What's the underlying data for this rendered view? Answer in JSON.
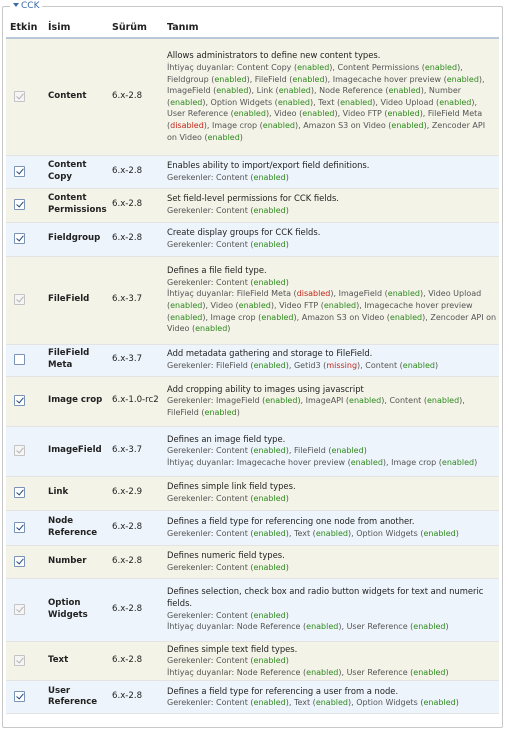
{
  "fieldset": {
    "legend": "CCK"
  },
  "table": {
    "headers": {
      "enabled": "Etkin",
      "name": "İsim",
      "version": "Sürüm",
      "description": "Tanım"
    },
    "required_by_label": "İhtiyaç duyanlar:",
    "depends_on_label": "Gerekenler:",
    "rows": [
      {
        "name": "Content",
        "version": "6.x-2.8",
        "checked": true,
        "locked": true,
        "description": "Allows administrators to define new content types.",
        "required_by": [
          [
            "Content Copy",
            "enabled"
          ],
          [
            "Content Permissions",
            "enabled"
          ],
          [
            "Fieldgroup",
            "enabled"
          ],
          [
            "FileField",
            "enabled"
          ],
          [
            "Imagecache hover preview",
            "enabled"
          ],
          [
            "ImageField",
            "enabled"
          ],
          [
            "Link",
            "enabled"
          ],
          [
            "Node Reference",
            "enabled"
          ],
          [
            "Number",
            "enabled"
          ],
          [
            "Option Widgets",
            "enabled"
          ],
          [
            "Text",
            "enabled"
          ],
          [
            "Video Upload",
            "enabled"
          ],
          [
            "User Reference",
            "enabled"
          ],
          [
            "Video",
            "enabled"
          ],
          [
            "Video FTP",
            "enabled"
          ],
          [
            "FileField Meta",
            "disabled"
          ],
          [
            "Image crop",
            "enabled"
          ],
          [
            "Amazon S3 on Video",
            "enabled"
          ],
          [
            "Zencoder API on Video",
            "enabled"
          ]
        ],
        "depends_on": []
      },
      {
        "name": "Content Copy",
        "version": "6.x-2.8",
        "checked": true,
        "locked": false,
        "description": "Enables ability to import/export field definitions.",
        "required_by": [],
        "depends_on": [
          [
            "Content",
            "enabled"
          ]
        ]
      },
      {
        "name": "Content Permissions",
        "version": "6.x-2.8",
        "checked": true,
        "locked": false,
        "description": "Set field-level permissions for CCK fields.",
        "required_by": [],
        "depends_on": [
          [
            "Content",
            "enabled"
          ]
        ]
      },
      {
        "name": "Fieldgroup",
        "version": "6.x-2.8",
        "checked": true,
        "locked": false,
        "description": "Create display groups for CCK fields.",
        "required_by": [],
        "depends_on": [
          [
            "Content",
            "enabled"
          ]
        ]
      },
      {
        "name": "FileField",
        "version": "6.x-3.7",
        "checked": true,
        "locked": true,
        "description": "Defines a file field type.",
        "depends_on": [
          [
            "Content",
            "enabled"
          ]
        ],
        "required_by": [
          [
            "FileField Meta",
            "disabled"
          ],
          [
            "ImageField",
            "enabled"
          ],
          [
            "Video Upload",
            "enabled"
          ],
          [
            "Video",
            "enabled"
          ],
          [
            "Video FTP",
            "enabled"
          ],
          [
            "Imagecache hover preview",
            "enabled"
          ],
          [
            "Image crop",
            "enabled"
          ],
          [
            "Amazon S3 on Video",
            "enabled"
          ],
          [
            "Zencoder API on Video",
            "enabled"
          ]
        ]
      },
      {
        "name": "FileField Meta",
        "version": "6.x-3.7",
        "checked": false,
        "locked": false,
        "description": "Add metadata gathering and storage to FileField.",
        "required_by": [],
        "depends_on": [
          [
            "FileField",
            "enabled"
          ],
          [
            "Getid3",
            "missing"
          ],
          [
            "Content",
            "enabled"
          ]
        ]
      },
      {
        "name": "Image crop",
        "version": "6.x-1.0-rc2",
        "checked": true,
        "locked": false,
        "description": "Add cropping ability to images using javascript",
        "required_by": [],
        "depends_on": [
          [
            "ImageField",
            "enabled"
          ],
          [
            "ImageAPI",
            "enabled"
          ],
          [
            "Content",
            "enabled"
          ],
          [
            "FileField",
            "enabled"
          ]
        ]
      },
      {
        "name": "ImageField",
        "version": "6.x-3.7",
        "checked": true,
        "locked": true,
        "description": "Defines an image field type.",
        "depends_on": [
          [
            "Content",
            "enabled"
          ],
          [
            "FileField",
            "enabled"
          ]
        ],
        "required_by": [
          [
            "Imagecache hover preview",
            "enabled"
          ],
          [
            "Image crop",
            "enabled"
          ]
        ]
      },
      {
        "name": "Link",
        "version": "6.x-2.9",
        "checked": true,
        "locked": false,
        "description": "Defines simple link field types.",
        "required_by": [],
        "depends_on": [
          [
            "Content",
            "enabled"
          ]
        ]
      },
      {
        "name": "Node Reference",
        "version": "6.x-2.8",
        "checked": true,
        "locked": false,
        "description": "Defines a field type for referencing one node from another.",
        "required_by": [],
        "depends_on": [
          [
            "Content",
            "enabled"
          ],
          [
            "Text",
            "enabled"
          ],
          [
            "Option Widgets",
            "enabled"
          ]
        ]
      },
      {
        "name": "Number",
        "version": "6.x-2.8",
        "checked": true,
        "locked": false,
        "description": "Defines numeric field types.",
        "required_by": [],
        "depends_on": [
          [
            "Content",
            "enabled"
          ]
        ]
      },
      {
        "name": "Option Widgets",
        "version": "6.x-2.8",
        "checked": true,
        "locked": true,
        "description": "Defines selection, check box and radio button widgets for text and numeric fields.",
        "depends_on": [
          [
            "Content",
            "enabled"
          ]
        ],
        "required_by": [
          [
            "Node Reference",
            "enabled"
          ],
          [
            "User Reference",
            "enabled"
          ]
        ]
      },
      {
        "name": "Text",
        "version": "6.x-2.8",
        "checked": true,
        "locked": true,
        "description": "Defines simple text field types.",
        "depends_on": [
          [
            "Content",
            "enabled"
          ]
        ],
        "required_by": [
          [
            "Node Reference",
            "enabled"
          ],
          [
            "User Reference",
            "enabled"
          ]
        ]
      },
      {
        "name": "User Reference",
        "version": "6.x-2.8",
        "checked": true,
        "locked": false,
        "description": "Defines a field type for referencing a user from a node.",
        "required_by": [],
        "depends_on": [
          [
            "Content",
            "enabled"
          ],
          [
            "Text",
            "enabled"
          ],
          [
            "Option Widgets",
            "enabled"
          ]
        ]
      }
    ]
  }
}
